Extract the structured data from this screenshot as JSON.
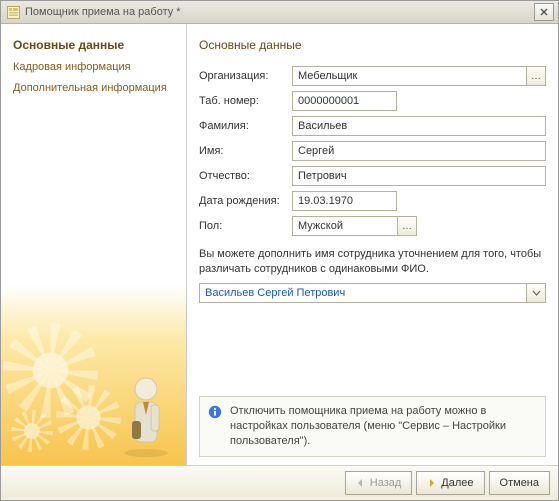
{
  "window": {
    "title": "Помощник приема на работу *"
  },
  "sidebar": {
    "items": [
      {
        "label": "Основные данные",
        "active": true
      },
      {
        "label": "Кадровая информация",
        "active": false
      },
      {
        "label": "Дополнительная информация",
        "active": false
      }
    ]
  },
  "main": {
    "section_title": "Основные данные",
    "fields": {
      "organization": {
        "label": "Организация:",
        "value": "Мебельщик"
      },
      "tab_number": {
        "label": "Таб. номер:",
        "value": "0000000001"
      },
      "last_name": {
        "label": "Фамилия:",
        "value": "Васильев"
      },
      "first_name": {
        "label": "Имя:",
        "value": "Сергей"
      },
      "patronymic": {
        "label": "Отчество:",
        "value": "Петрович"
      },
      "birth_date": {
        "label": "Дата рождения:",
        "value": "19.03.1970"
      },
      "gender": {
        "label": "Пол:",
        "value": "Мужской"
      }
    },
    "hint_text": "Вы можете дополнить имя сотрудника уточнением для того, чтобы различать сотрудников с одинаковыми ФИО.",
    "full_name_select": "Васильев Сергей Петрович",
    "info_text": "Отключить помощника приема на работу можно в настройках пользователя (меню \"Сервис – Настройки пользователя\")."
  },
  "footer": {
    "back_label": "Назад",
    "next_label": "Далее",
    "cancel_label": "Отмена"
  },
  "colors": {
    "accent": "#f7c44d"
  }
}
